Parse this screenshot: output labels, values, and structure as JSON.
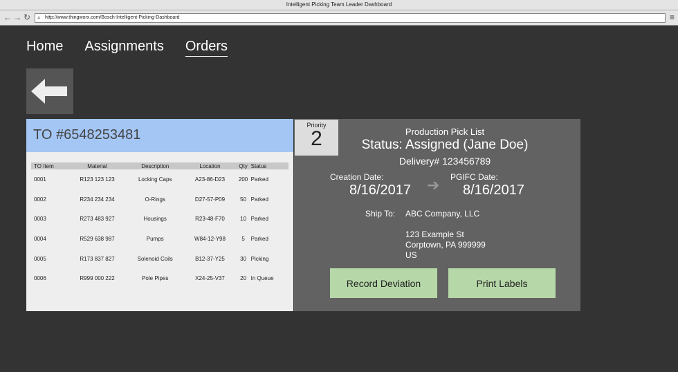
{
  "browser": {
    "title": "Intelligent Picking Team Leader Dashboard",
    "url": "http://www.thingworx.com/Bosch-Intelligent-Picking-Dashboard"
  },
  "nav": {
    "home": "Home",
    "assignments": "Assignments",
    "orders": "Orders"
  },
  "order": {
    "title": "TO #6548253481"
  },
  "table": {
    "headers": [
      "TO Item",
      "Material",
      "Description",
      "Location",
      "Qty",
      "Status"
    ],
    "rows": [
      [
        "0001",
        "R123 123 123",
        "Locking Caps",
        "A23-86-D23",
        "200",
        "Parked"
      ],
      [
        "0002",
        "R234 234 234",
        "O-Rings",
        "D27-57-P09",
        "50",
        "Parked"
      ],
      [
        "0003",
        "R273 483 927",
        "Housings",
        "R23-48-F70",
        "10",
        "Parked"
      ],
      [
        "0004",
        "R529 638 987",
        "Pumps",
        "W84-12-Y98",
        "5",
        "Parked"
      ],
      [
        "0005",
        "R173 837 827",
        "Solenoid Coils",
        "B12-37-Y25",
        "30",
        "Picking"
      ],
      [
        "0006",
        "R999 000 222",
        "Pole Pipes",
        "X24-25-V37",
        "20",
        "In Queue"
      ]
    ]
  },
  "detail": {
    "priority_label": "Priority",
    "priority": "2",
    "list_title": "Production Pick List",
    "status": "Status: Assigned (Jane Doe)",
    "delivery": "Delivery# 123456789",
    "creation_label": "Creation Date:",
    "creation_date": "8/16/2017",
    "pgifc_label": "PGIFC Date:",
    "pgifc_date": "8/16/2017",
    "ship_label": "Ship To:",
    "ship_lines": [
      "ABC Company, LLC",
      "",
      "123 Example St",
      "Corptown, PA 999999",
      "US"
    ],
    "record_deviation": "Record Deviation",
    "print_labels": "Print Labels"
  }
}
